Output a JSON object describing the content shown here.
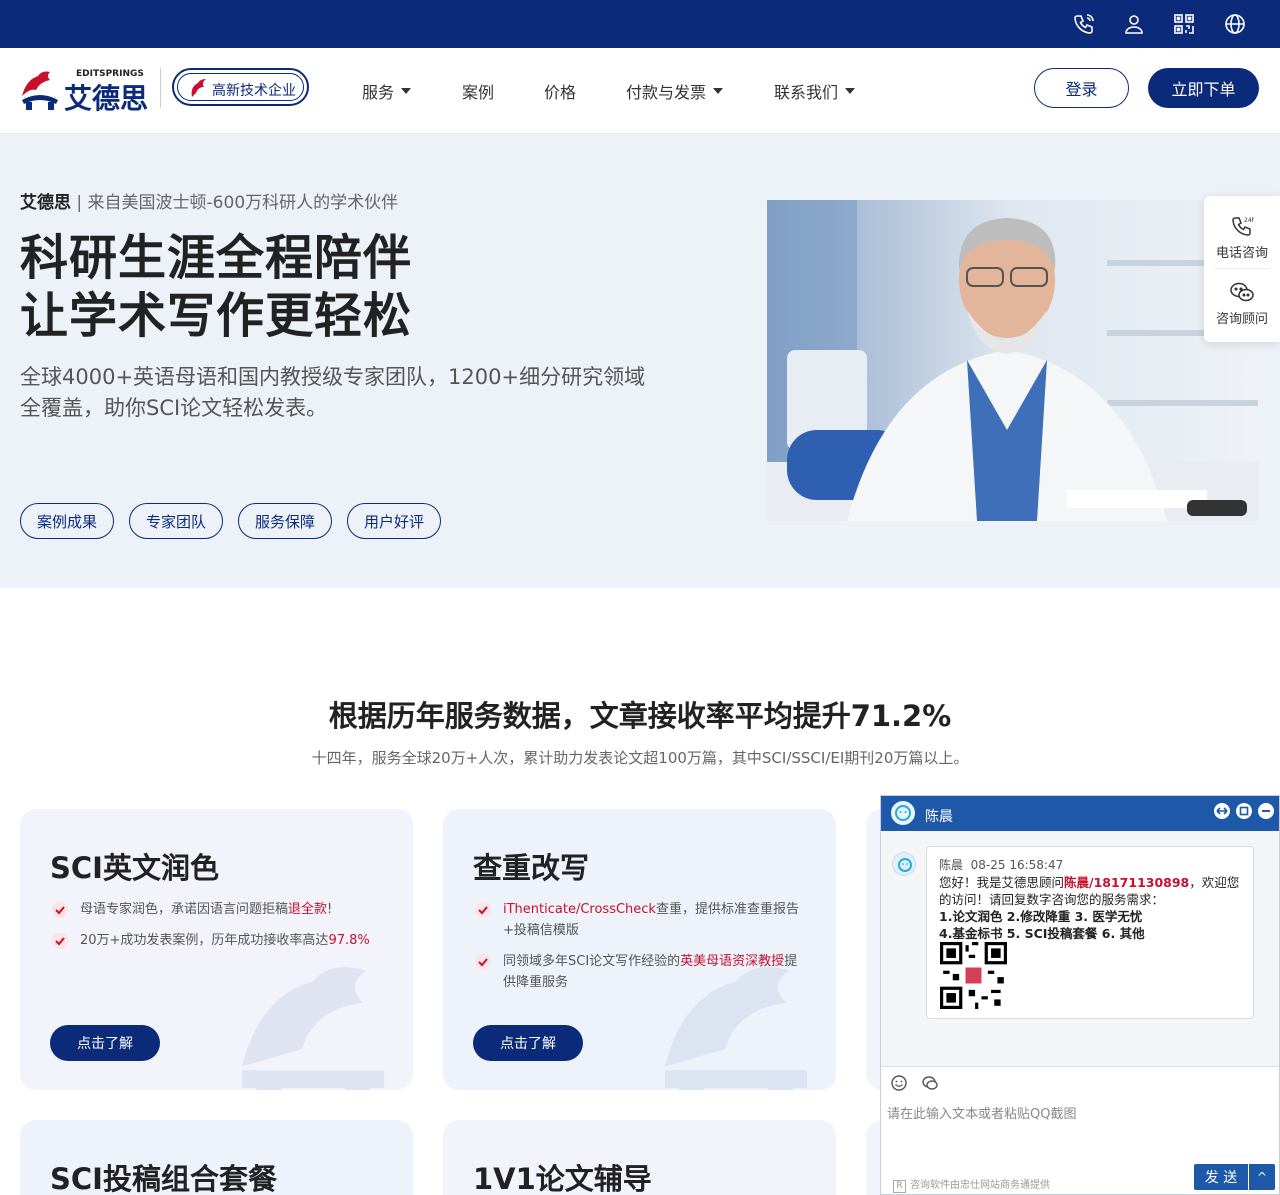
{
  "colors": {
    "brand": "#0b2a7a",
    "accent_red": "#c8102e",
    "chat_blue": "#1e58a8"
  },
  "topbar": {
    "icons": [
      "phone-icon",
      "user-icon",
      "qrcode-icon",
      "globe-icon"
    ]
  },
  "nav": {
    "logo_en": "EDITSPRINGS",
    "logo_cn": "艾德思",
    "badge": "高新技术企业",
    "items": [
      {
        "label": "服务",
        "dropdown": true
      },
      {
        "label": "案例",
        "dropdown": false
      },
      {
        "label": "价格",
        "dropdown": false
      },
      {
        "label": "付款与发票",
        "dropdown": true
      },
      {
        "label": "联系我们",
        "dropdown": true
      }
    ],
    "login": "登录",
    "order": "立即下单"
  },
  "hero": {
    "brand": "艾德思",
    "tagline": "来自美国波士顿-600万科研人的学术伙伴",
    "headline_1": "科研生涯全程陪伴",
    "headline_2": "让学术写作更轻松",
    "subline": "全球4000+英语母语和国内教授级专家团队，1200+细分研究领域全覆盖，助你SCI论文轻松发表。",
    "pills": [
      "案例成果",
      "专家团队",
      "服务保障",
      "用户好评"
    ]
  },
  "side_float": {
    "phone": "电话咨询",
    "consult": "咨询顾问"
  },
  "stats": {
    "title": "根据历年服务数据，文章接收率平均提升71.2%",
    "subtitle": "十四年，服务全球20万+人次，累计助力发表论文超100万篇，其中SCI/SSCI/EI期刊20万篇以上。"
  },
  "cards": [
    {
      "title": "SCI英文润色",
      "items": [
        {
          "text": "母语专家润色，承诺因语言问题拒稿",
          "hl": "退全款",
          "tail": "!"
        },
        {
          "text": "20万+成功发表案例，历年成功接收率高达",
          "hl": "97.8%",
          "tail": ""
        }
      ],
      "button": "点击了解"
    },
    {
      "title": "查重改写",
      "items": [
        {
          "pre_hl": "iThenticate/CrossCheck",
          "text": "查重，提供标准查重报告+投稿信模版"
        },
        {
          "text": "同领域多年SCI论文写作经验的",
          "hl": "英美母语资深教授",
          "tail": "提供降重服务"
        }
      ],
      "button": "点击了解"
    },
    {
      "title": "SCI投稿组合套餐"
    },
    {
      "title": "1V1论文辅导"
    }
  ],
  "chat": {
    "agent": "陈晨",
    "meta_name": "陈晨",
    "meta_time": "08-25 16:58:47",
    "greeting_pre": "您好！我是艾德思顾问",
    "greeting_hl": "陈晨/18171130898",
    "greeting_post": "，欢迎您的访问！请回复数字咨询您的服务需求：",
    "options_1": "1.论文润色 2.修改降重 3. 医学无忧",
    "options_2": "4.基金标书 5. SCI投稿套餐 6. 其他",
    "input_placeholder": "请在此输入文本或者粘贴QQ截图",
    "footer": "咨询软件由忠仕网站商务通提供",
    "send": "发 送",
    "send_more": "^"
  }
}
